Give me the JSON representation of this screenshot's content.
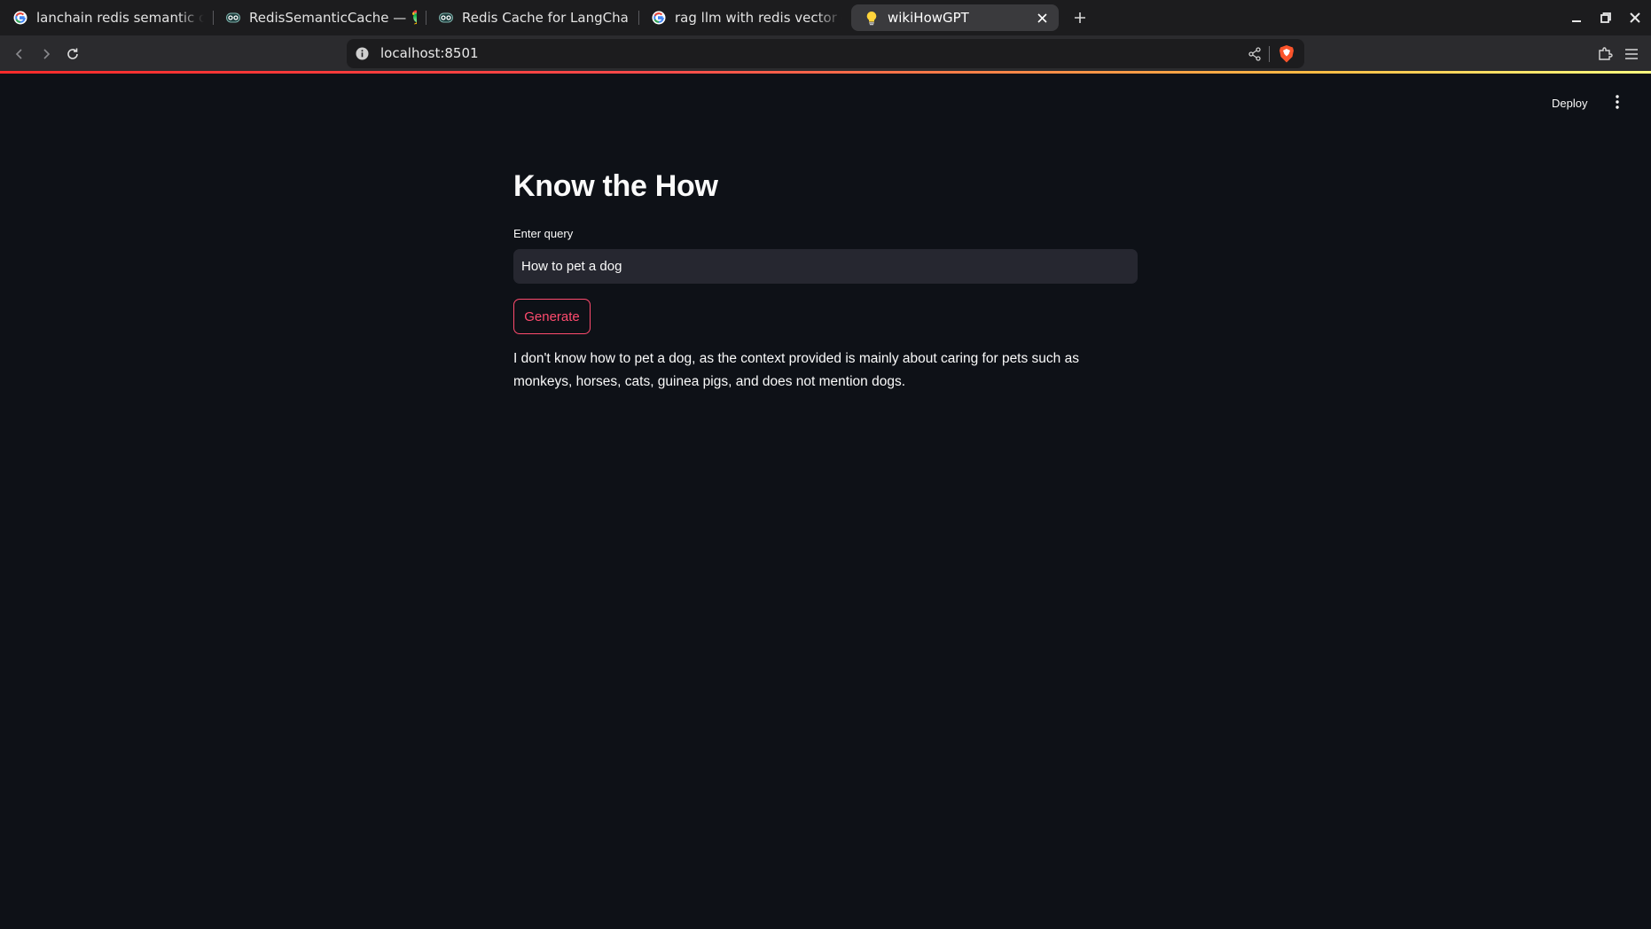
{
  "browser": {
    "tabs": [
      {
        "title": "lanchain redis semantic cach",
        "icon": "google-icon"
      },
      {
        "title": "RedisSemanticCache — 🦜🔗",
        "icon": "langchain-icon"
      },
      {
        "title": "Redis Cache for LangChain |",
        "icon": "langchain-icon"
      },
      {
        "title": "rag llm with redis vector dat",
        "icon": "google-icon"
      },
      {
        "title": "wikiHowGPT",
        "icon": "lightbulb-icon",
        "active": true
      }
    ],
    "address": "localhost:8501"
  },
  "app": {
    "deploy_label": "Deploy",
    "title": "Know the How",
    "query_label": "Enter query",
    "query_value": "How to pet a dog",
    "generate_label": "Generate",
    "answer": "I don't know how to pet a dog, as the context provided is mainly about caring for pets such as monkeys, horses, cats, guinea pigs, and does not mention dogs."
  },
  "colors": {
    "page_background": "#0e1117",
    "accent": "#ff4b6e",
    "input_background": "#262730"
  }
}
